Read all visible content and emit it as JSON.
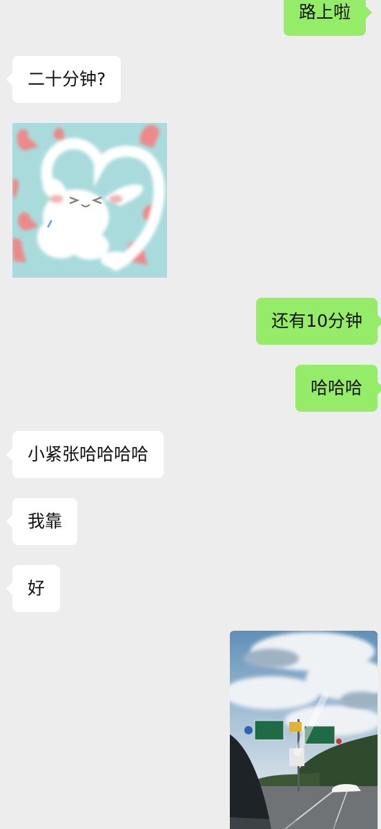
{
  "messages": [
    {
      "side": "out",
      "type": "text",
      "text": "路上啦"
    },
    {
      "side": "in",
      "type": "text",
      "text": "二十分钟?"
    },
    {
      "side": "in",
      "type": "sticker",
      "icon": "cat-heart-sticker-icon"
    },
    {
      "side": "out",
      "type": "text",
      "text": "还有10分钟"
    },
    {
      "side": "out",
      "type": "text",
      "text": "哈哈哈"
    },
    {
      "side": "in",
      "type": "text",
      "text": "小紧张哈哈哈哈"
    },
    {
      "side": "in",
      "type": "text",
      "text": "我靠"
    },
    {
      "side": "in",
      "type": "text",
      "text": "好"
    },
    {
      "side": "out",
      "type": "image",
      "icon": "highway-road-sign-photo"
    }
  ],
  "colors": {
    "background": "#ededed",
    "incoming_bubble": "#ffffff",
    "outgoing_bubble": "#95ec69",
    "text": "#111111"
  }
}
